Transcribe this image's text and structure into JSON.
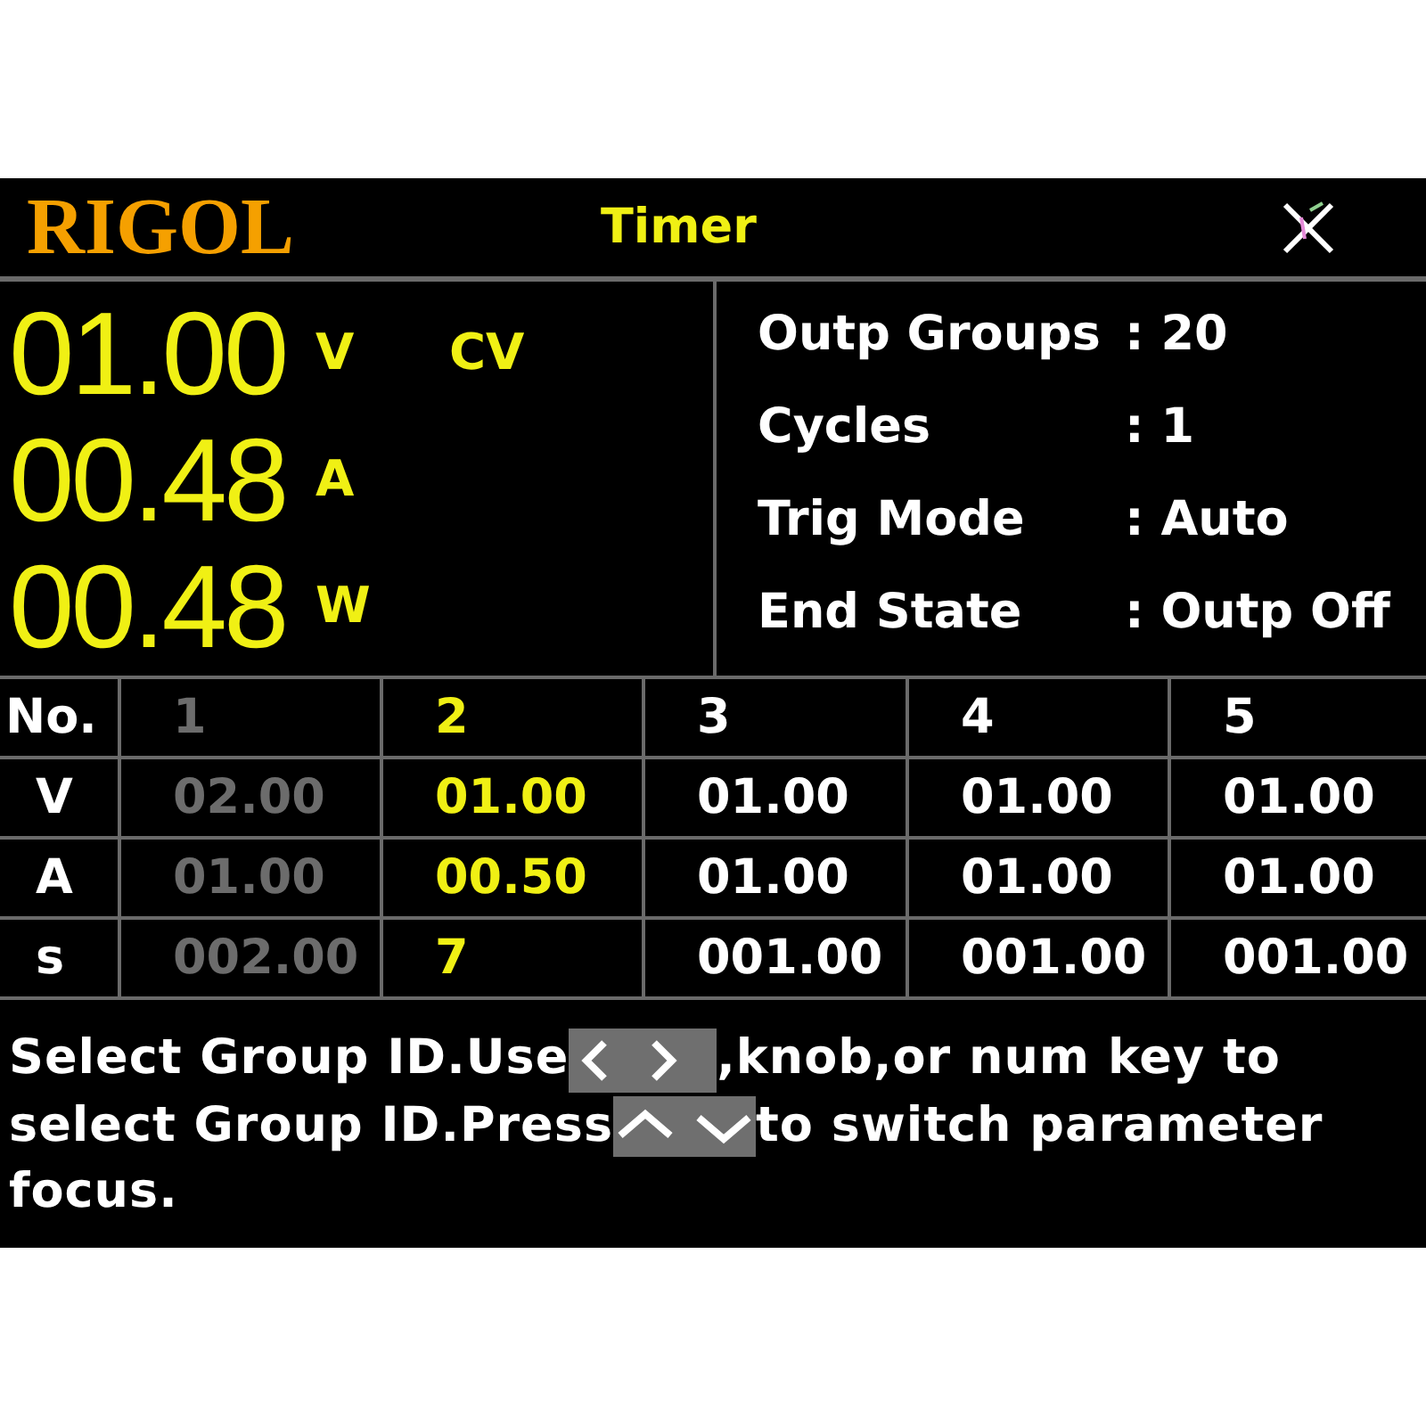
{
  "header": {
    "logo": "RIGOL",
    "title": "Timer"
  },
  "readings": {
    "mode": "CV",
    "values": [
      {
        "value": "01.00",
        "unit": "V"
      },
      {
        "value": "00.48",
        "unit": "A"
      },
      {
        "value": "00.48",
        "unit": "W"
      }
    ]
  },
  "settings": [
    {
      "label": "Outp Groups",
      "value": ": 20"
    },
    {
      "label": "Cycles",
      "value": ": 1"
    },
    {
      "label": "Trig Mode",
      "value": ": Auto"
    },
    {
      "label": "End State",
      "value": ": Outp Off"
    }
  ],
  "table": {
    "row_labels": [
      "No.",
      "V",
      "A",
      "s"
    ],
    "groups": [
      {
        "no": "1",
        "v": "02.00",
        "a": "01.00",
        "s": "002.00",
        "selected": false,
        "disabled": true
      },
      {
        "no": "2",
        "v": "01.00",
        "a": "00.50",
        "s": "7",
        "selected": true,
        "disabled": false
      },
      {
        "no": "3",
        "v": "01.00",
        "a": "01.00",
        "s": "001.00",
        "selected": false,
        "disabled": false
      },
      {
        "no": "4",
        "v": "01.00",
        "a": "01.00",
        "s": "001.00",
        "selected": false,
        "disabled": false
      },
      {
        "no": "5",
        "v": "01.00",
        "a": "01.00",
        "s": "001.00",
        "selected": false,
        "disabled": false
      }
    ]
  },
  "help": {
    "parts": [
      {
        "kind": "text",
        "text": "Select Group ID.Use"
      },
      {
        "kind": "left_right_keys"
      },
      {
        "kind": "text",
        "text": ",knob,or num key to select Group ID.Press"
      },
      {
        "kind": "up_down_keys"
      },
      {
        "kind": "text",
        "text": "to switch parameter focus."
      }
    ]
  }
}
